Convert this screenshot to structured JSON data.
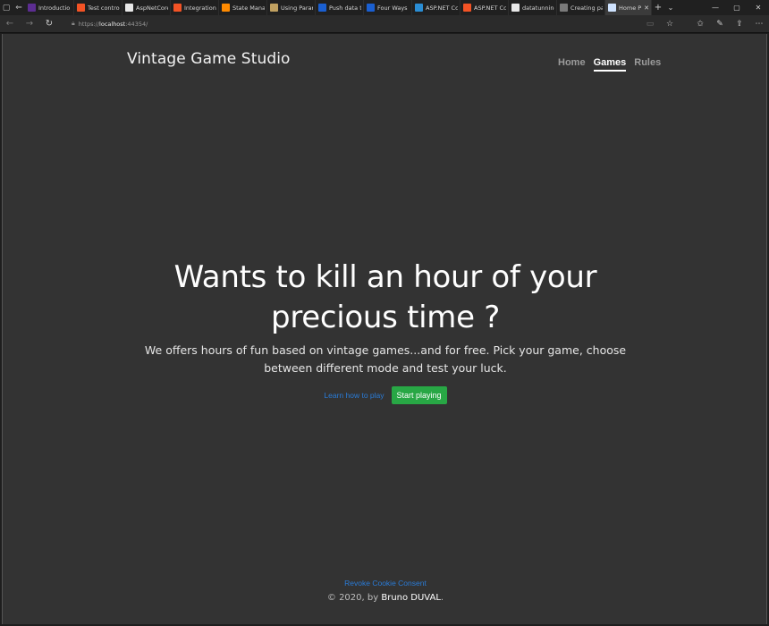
{
  "browser": {
    "tabs": [
      {
        "label": "Introductio",
        "color": "#5c2d91"
      },
      {
        "label": "Test control",
        "color": "#f35325"
      },
      {
        "label": "AspNetCore",
        "color": "#e8e8e8"
      },
      {
        "label": "Integration",
        "color": "#f35325"
      },
      {
        "label": "State Mana",
        "color": "#ff8a00"
      },
      {
        "label": "Using Parar",
        "color": "#c0a060"
      },
      {
        "label": "Push data t",
        "color": "#1a5fd1"
      },
      {
        "label": "Four Ways",
        "color": "#1a5fd1"
      },
      {
        "label": "ASP.NET Cc",
        "color": "#2a8dd4"
      },
      {
        "label": "ASP.NET Cc",
        "color": "#f35325"
      },
      {
        "label": "datatunning",
        "color": "#e8e8e8"
      },
      {
        "label": "Creating pa",
        "color": "#7a7a7a"
      },
      {
        "label": "Home P",
        "color": "#cfe3ff"
      }
    ],
    "url_prefix": "https://",
    "url_host": "localhost",
    "url_rest": ":44354/"
  },
  "site": {
    "brand": "Vintage Game Studio",
    "nav": [
      {
        "label": "Home"
      },
      {
        "label": "Games"
      },
      {
        "label": "Rules"
      }
    ]
  },
  "hero": {
    "title": "Wants to kill an hour of your precious time ?",
    "subtitle": "We offers hours of fun based on vintage games...and for free. Pick your game, choose between different mode and test your luck.",
    "learn_link": "Learn how to play",
    "start_button": "Start playing"
  },
  "footer": {
    "revoke": "Revoke Cookie Consent",
    "copyright": "© 2020, by",
    "author": "Bruno DUVAL",
    "period": "."
  }
}
